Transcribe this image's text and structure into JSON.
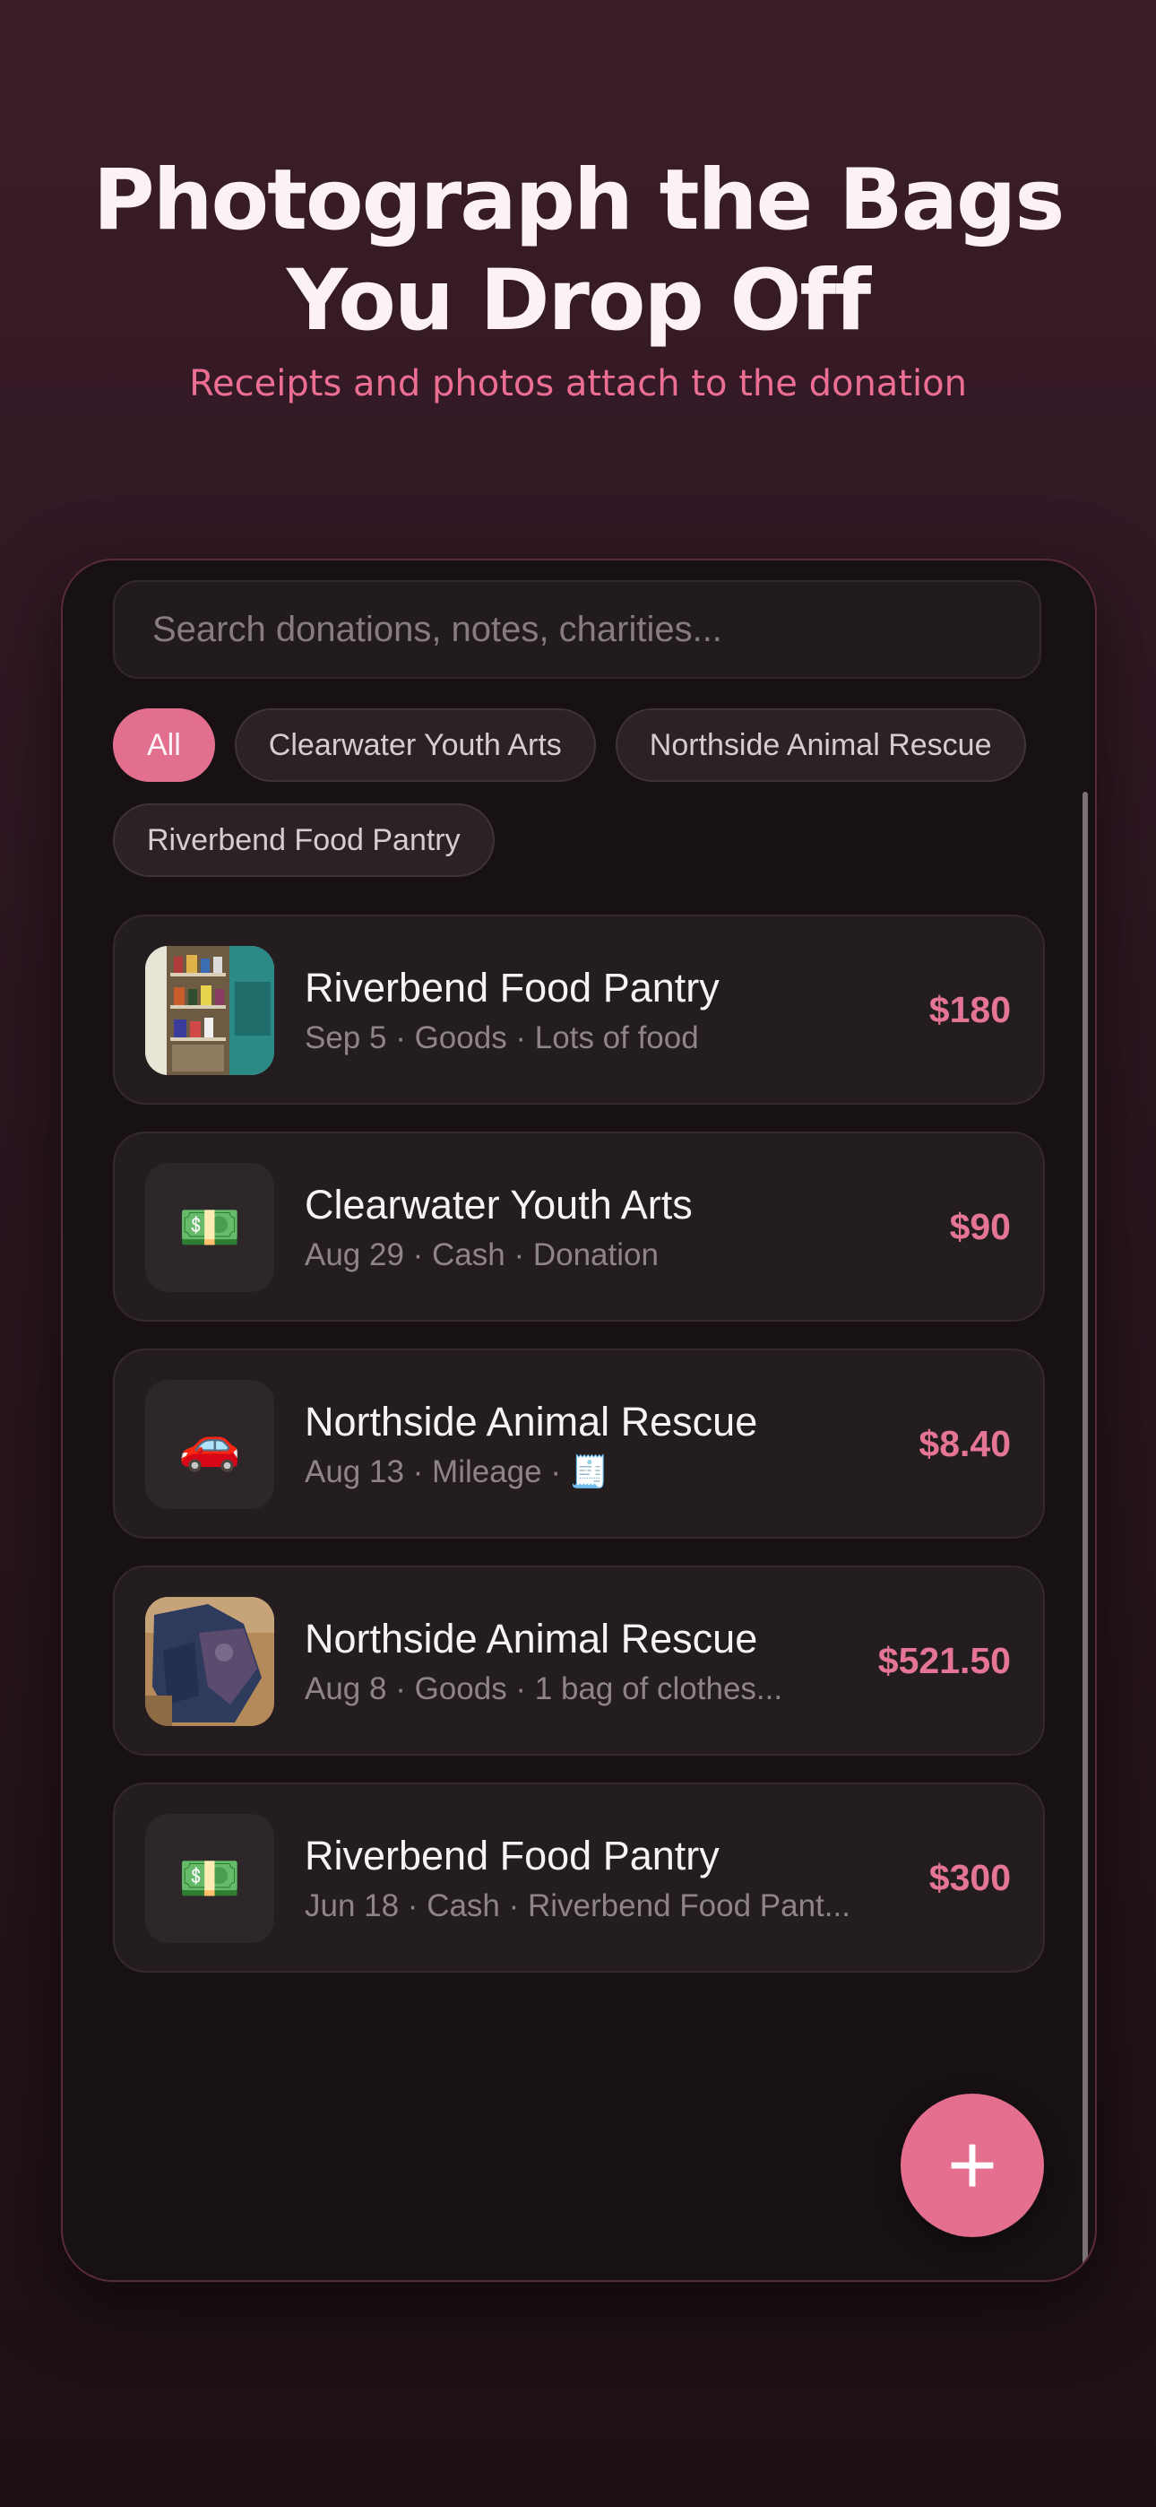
{
  "hero": {
    "title": "Photograph the Bags\nYou Drop Off",
    "subtitle": "Receipts and photos attach to the donation"
  },
  "search": {
    "placeholder": "Search donations, notes, charities..."
  },
  "filters": [
    {
      "label": "All",
      "active": true
    },
    {
      "label": "Clearwater Youth Arts",
      "active": false
    },
    {
      "label": "Northside Animal Rescue",
      "active": false
    },
    {
      "label": "Riverbend Food Pantry",
      "active": false
    }
  ],
  "donations": [
    {
      "charity": "Riverbend Food Pantry",
      "meta": "Sep 5 · Goods · Lots of food",
      "amount": "$180",
      "icon": "pantry-photo"
    },
    {
      "charity": "Clearwater Youth Arts",
      "meta": "Aug 29 · Cash · Donation",
      "amount": "$90",
      "icon": "cash-icon",
      "glyph": "💵"
    },
    {
      "charity": "Northside Animal Rescue",
      "meta": "Aug 13 · Mileage · 🧾",
      "amount": "$8.40",
      "icon": "car-icon",
      "glyph": "🚗"
    },
    {
      "charity": "Northside Animal Rescue",
      "meta": "Aug 8 · Goods · 1 bag of clothes...",
      "amount": "$521.50",
      "icon": "clothes-photo"
    },
    {
      "charity": "Riverbend Food Pantry",
      "meta": "Jun 18 · Cash · Riverbend Food Pant...",
      "amount": "$300",
      "icon": "cash-icon",
      "glyph": "💵"
    }
  ],
  "fab": {
    "label": "+",
    "icon": "plus-icon"
  },
  "colors": {
    "accent": "#e46f8f",
    "subtitle": "#ec6f93",
    "card": "#231d20",
    "background": "#2c1620"
  }
}
